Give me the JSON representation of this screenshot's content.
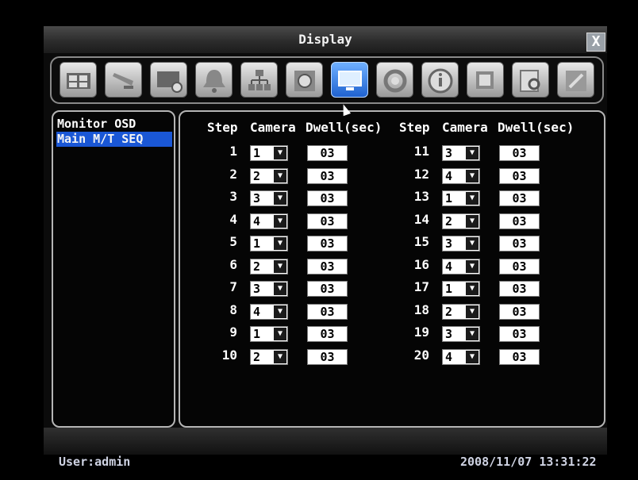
{
  "window": {
    "title": "Display",
    "close_label": "X"
  },
  "toolbar": {
    "tools": [
      {
        "name": "camera-tool",
        "active": false
      },
      {
        "name": "record-tool",
        "active": false
      },
      {
        "name": "schedule-tool",
        "active": false
      },
      {
        "name": "alarm-tool",
        "active": false
      },
      {
        "name": "network-tool",
        "active": false
      },
      {
        "name": "disk-tool",
        "active": false
      },
      {
        "name": "display-tool",
        "active": true
      },
      {
        "name": "system-tool",
        "active": false
      },
      {
        "name": "info-tool",
        "active": false
      },
      {
        "name": "playback-tool",
        "active": false
      },
      {
        "name": "search-tool",
        "active": false
      },
      {
        "name": "user-tool",
        "active": false
      }
    ]
  },
  "sidebar": {
    "items": [
      "Monitor OSD",
      "Main M/T SEQ"
    ],
    "selected": 1
  },
  "table": {
    "headers": {
      "step": "Step",
      "camera": "Camera",
      "dwell": "Dwell(sec)"
    },
    "left": [
      {
        "step": "1",
        "camera": "1",
        "dwell": "03"
      },
      {
        "step": "2",
        "camera": "2",
        "dwell": "03"
      },
      {
        "step": "3",
        "camera": "3",
        "dwell": "03"
      },
      {
        "step": "4",
        "camera": "4",
        "dwell": "03"
      },
      {
        "step": "5",
        "camera": "1",
        "dwell": "03"
      },
      {
        "step": "6",
        "camera": "2",
        "dwell": "03"
      },
      {
        "step": "7",
        "camera": "3",
        "dwell": "03"
      },
      {
        "step": "8",
        "camera": "4",
        "dwell": "03"
      },
      {
        "step": "9",
        "camera": "1",
        "dwell": "03"
      },
      {
        "step": "10",
        "camera": "2",
        "dwell": "03"
      }
    ],
    "right": [
      {
        "step": "11",
        "camera": "3",
        "dwell": "03"
      },
      {
        "step": "12",
        "camera": "4",
        "dwell": "03"
      },
      {
        "step": "13",
        "camera": "1",
        "dwell": "03"
      },
      {
        "step": "14",
        "camera": "2",
        "dwell": "03"
      },
      {
        "step": "15",
        "camera": "3",
        "dwell": "03"
      },
      {
        "step": "16",
        "camera": "4",
        "dwell": "03"
      },
      {
        "step": "17",
        "camera": "1",
        "dwell": "03"
      },
      {
        "step": "18",
        "camera": "2",
        "dwell": "03"
      },
      {
        "step": "19",
        "camera": "3",
        "dwell": "03"
      },
      {
        "step": "20",
        "camera": "4",
        "dwell": "03"
      }
    ]
  },
  "status": {
    "user": "User:admin",
    "datetime": "2008/11/07  13:31:22"
  },
  "colors": {
    "accent": "#1a57d6",
    "active_tool": "#2f7be8"
  }
}
